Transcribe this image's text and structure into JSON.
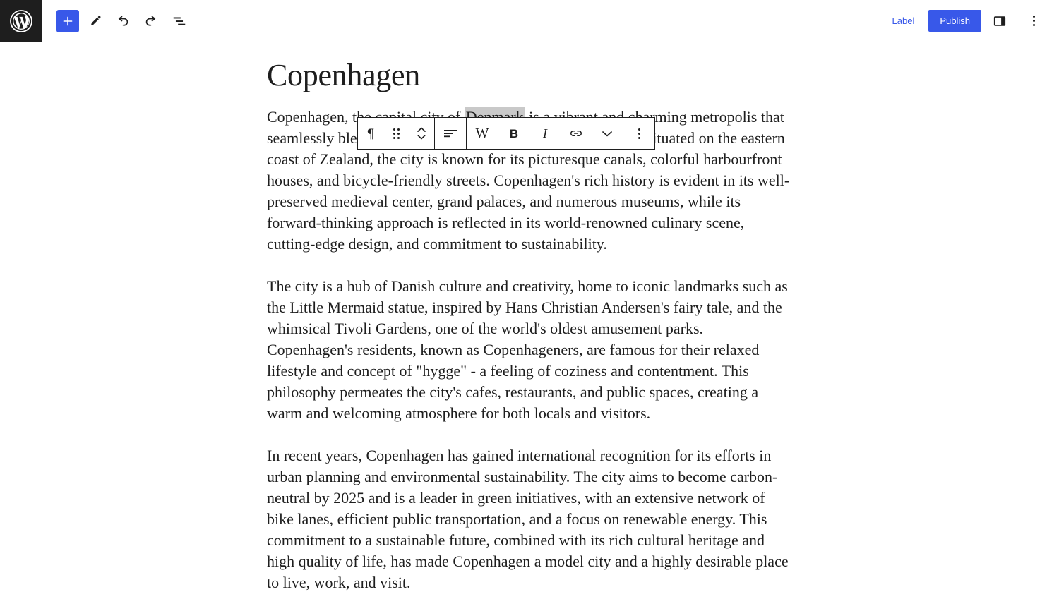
{
  "app": {
    "name": "WordPress Block Editor",
    "logo_icon": "wordpress-logo-icon"
  },
  "header": {
    "logo_label": "W",
    "left_tools": [
      {
        "name": "add-block-button",
        "label": "+",
        "icon": "plus-icon",
        "primary": true
      },
      {
        "name": "edit-tool-button",
        "label": "",
        "icon": "pencil-icon",
        "primary": false
      },
      {
        "name": "undo-button",
        "label": "",
        "icon": "undo-arrow-icon",
        "primary": false
      },
      {
        "name": "redo-button",
        "label": "",
        "icon": "redo-arrow-icon",
        "primary": false
      },
      {
        "name": "document-overview-button",
        "label": "",
        "icon": "document-outline-icon",
        "primary": false
      }
    ],
    "label_button": "Label",
    "publish_button": "Publish",
    "settings_sidebar_icon": "sidebar-panel-icon",
    "options_icon": "kebab-menu-icon"
  },
  "block_toolbar": {
    "groups": [
      {
        "name": "block-type-group",
        "buttons": [
          {
            "name": "block-type-paragraph-button",
            "icon": "paragraph-pilcrow-icon",
            "glyph": "¶",
            "kind": "text"
          },
          {
            "name": "drag-handle-button",
            "icon": "drag-handle-icon",
            "glyph": "",
            "kind": "dots6"
          },
          {
            "name": "move-block-updown-button",
            "icon": "chevron-up-down-icon",
            "glyph": "",
            "kind": "updown"
          }
        ]
      },
      {
        "name": "alignment-group",
        "buttons": [
          {
            "name": "align-text-button",
            "icon": "align-left-icon",
            "glyph": "",
            "kind": "align"
          }
        ]
      },
      {
        "name": "wikipedia-group",
        "buttons": [
          {
            "name": "wikipedia-lookup-button",
            "icon": "wikipedia-w-icon",
            "glyph": "W",
            "kind": "w"
          }
        ]
      },
      {
        "name": "text-formatting-group",
        "buttons": [
          {
            "name": "bold-button",
            "icon": "bold-icon",
            "glyph": "B",
            "kind": "bold"
          },
          {
            "name": "italic-button",
            "icon": "italic-icon",
            "glyph": "I",
            "kind": "italic"
          },
          {
            "name": "link-button",
            "icon": "link-chain-icon",
            "glyph": "",
            "kind": "link"
          },
          {
            "name": "more-formatting-button",
            "icon": "chevron-down-icon",
            "glyph": "",
            "kind": "chevdown"
          }
        ]
      },
      {
        "name": "block-options-group",
        "buttons": [
          {
            "name": "block-options-button",
            "icon": "kebab-menu-icon",
            "glyph": "",
            "kind": "vdots"
          }
        ]
      }
    ]
  },
  "post": {
    "title": "Copenhagen",
    "paragraphs": [
      {
        "id": "paragraph-1",
        "before_selection": "Copenhagen, the capital city of ",
        "selection": "Denmark",
        "after_selection": " is a vibrant and charming metropolis that seamlessly blends historical charm with modern innovation. Situated on the eastern coast of Zealand, the city is known for its picturesque canals, colorful harbourfront houses, and bicycle-friendly streets. Copenhagen's rich history is evident in its well-preserved medieval center, grand palaces, and numerous museums, while its forward-thinking approach is reflected in its world-renowned culinary scene, cutting-edge design, and commitment to sustainability."
      },
      {
        "id": "paragraph-2",
        "text": "The city is a hub of Danish culture and creativity, home to iconic landmarks such as the Little Mermaid statue, inspired by Hans Christian Andersen's fairy tale, and the whimsical Tivoli Gardens, one of the world's oldest amusement parks. Copenhagen's residents, known as Copenhageners, are famous for their relaxed lifestyle and concept of \"hygge\" - a feeling of coziness and contentment. This philosophy permeates the city's cafes, restaurants, and public spaces, creating a warm and welcoming atmosphere for both locals and visitors."
      },
      {
        "id": "paragraph-3",
        "text": "In recent years, Copenhagen has gained international recognition for its efforts in urban planning and environmental sustainability. The city aims to become carbon-neutral by 2025 and is a leader in green initiatives, with an extensive network of bike lanes, efficient public transportation, and a focus on renewable energy. This commitment to a sustainable future, combined with its rich cultural heritage and high quality of life, has made Copenhagen a model city and a highly desirable place to live, work, and visit."
      }
    ]
  },
  "colors": {
    "accent": "#3858e9",
    "header_bg": "#ffffff",
    "logo_bg": "#1e1e1e",
    "text": "#1e1e1e",
    "selection_highlight": "#c9c9c9",
    "border": "#e0e0e0",
    "toolbar_border": "#1e1e1e"
  }
}
